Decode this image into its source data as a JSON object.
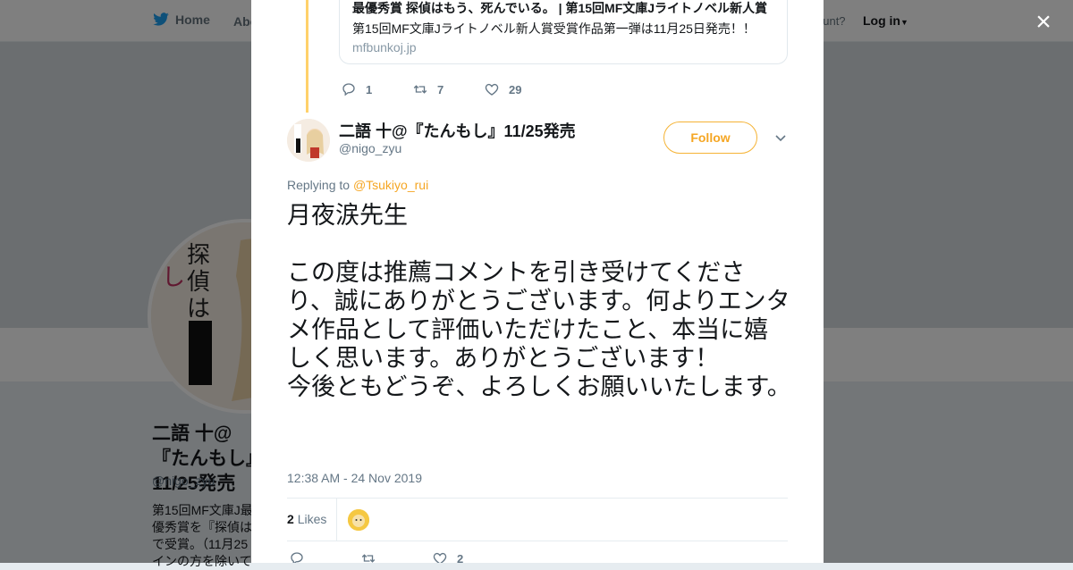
{
  "background": {
    "nav": {
      "home": "Home",
      "about": "Abo",
      "account": "ccount?",
      "login": "Log in"
    },
    "profile": {
      "name": "二語 十@『たんもし』11/25発売",
      "handle": "@nigo_zyu",
      "bio": "第15回MF文庫J最優秀賞を『探偵はで受賞。（11月25インの方を除いて"
    }
  },
  "close_label": "×",
  "quoted_card": {
    "title": "最優秀賞 探偵はもう、死んでいる。 | 第15回MF文庫Jライトノベル新人賞",
    "description": "第15回MF文庫Jライトノベル新人賞受賞作品第一弾は11月25日発売！！",
    "domain": "mfbunkoj.jp"
  },
  "parent_actions": {
    "replies": "1",
    "retweets": "7",
    "likes": "29"
  },
  "tweet": {
    "name": "二語 十@『たんもし』11/25発売",
    "handle": "@nigo_zyu",
    "follow": "Follow",
    "replying_prefix": "Replying to ",
    "replying_to": "@Tsukiyo_rui",
    "lines": [
      "月夜涙先生",
      "",
      "この度は推薦コメントを引き受けてくださり、誠にありがとうございます。何よりエンタメ作品として評価いただけたこと、本当に嬉しく思います。ありがとうございます！",
      "今後ともどうぞ、よろしくお願いいたします。"
    ],
    "time": "12:38 AM - 24 Nov 2019",
    "likes_count": "2",
    "likes_label": "Likes",
    "action_likes": "2"
  },
  "colors": {
    "accent": "#f5a623",
    "thread": "#ffd16a",
    "text": "#14171a",
    "muted": "#657786"
  }
}
